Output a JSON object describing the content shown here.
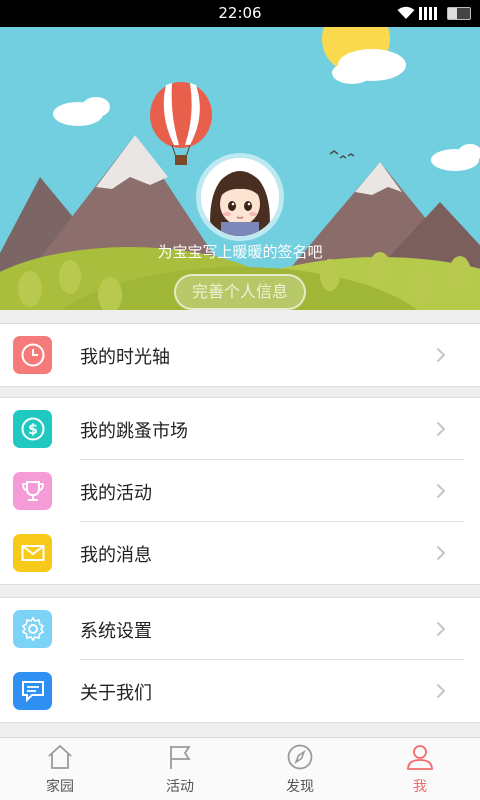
{
  "status_bar": {
    "time": "22:06"
  },
  "profile": {
    "signature": "为宝宝写上暖暖的签名吧",
    "complete_button": "完善个人信息"
  },
  "menu": {
    "timeline": {
      "label": "我的时光轴",
      "icon": "clock-icon",
      "color": "#f57a7a"
    },
    "market": {
      "label": "我的跳蚤市场",
      "icon": "dollar-coin-icon",
      "color": "#1fc9c0"
    },
    "activity": {
      "label": "我的活动",
      "icon": "trophy-icon",
      "color": "#f49bd8"
    },
    "messages": {
      "label": "我的消息",
      "icon": "envelope-icon",
      "color": "#f7c91b"
    },
    "settings": {
      "label": "系统设置",
      "icon": "gear-icon",
      "color": "#7dd3f5"
    },
    "about": {
      "label": "关于我们",
      "icon": "chat-bubble-icon",
      "color": "#2f8ff2"
    }
  },
  "tabs": [
    {
      "label": "家园",
      "icon": "home-icon"
    },
    {
      "label": "活动",
      "icon": "flag-icon"
    },
    {
      "label": "发现",
      "icon": "compass-icon"
    },
    {
      "label": "我",
      "icon": "person-icon",
      "active": true
    }
  ],
  "colors": {
    "accent": "#f26b6b",
    "hero_sky": "#72cfe0"
  }
}
